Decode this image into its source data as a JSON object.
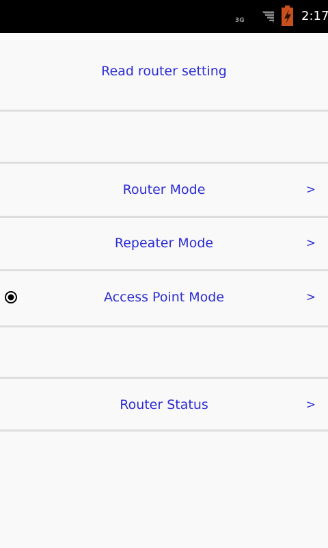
{
  "status_bar": {
    "network": "3G",
    "time": "2:17",
    "icons": [
      "signal-icon",
      "battery-icon"
    ]
  },
  "menu": {
    "read_setting": "Read router setting",
    "items": [
      {
        "label": "Router Mode",
        "chevron": ">",
        "selected": false
      },
      {
        "label": "Repeater Mode",
        "chevron": ">",
        "selected": false
      },
      {
        "label": "Access Point Mode",
        "chevron": ">",
        "selected": true
      },
      {
        "label": "Router Status",
        "chevron": ">",
        "selected": false
      }
    ]
  },
  "colors": {
    "accent": "#2b2bd4",
    "background": "#f9f9f9",
    "divider": "#dedede",
    "status_bar": "#000000"
  }
}
